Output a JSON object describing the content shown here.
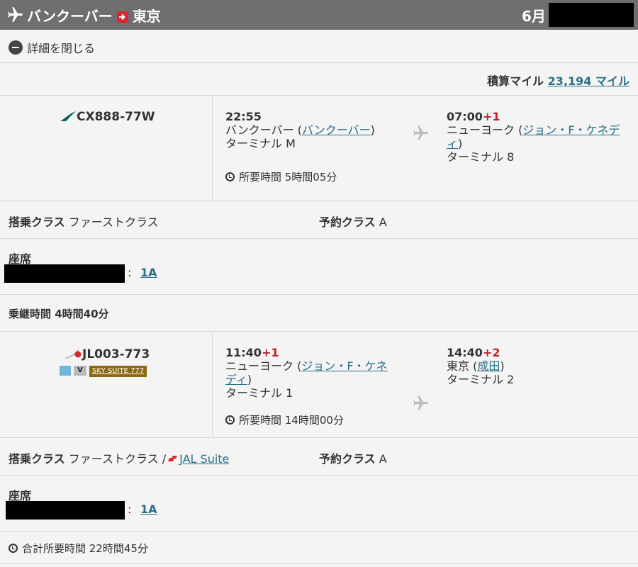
{
  "header": {
    "origin": "バンクーバー",
    "destination": "東京",
    "month": "6月"
  },
  "details_toggle": {
    "label": "詳細を閉じる"
  },
  "miles": {
    "label": "積算マイル",
    "value": "23,194 マイル"
  },
  "segments": [
    {
      "flight_number": "CX888-77W",
      "depart": {
        "time": "22:55",
        "day_offset": "",
        "city": "バンクーバー",
        "airport": "バンクーバー",
        "terminal": "ターミナル M"
      },
      "arrive": {
        "time": "07:00",
        "day_offset": "+1",
        "city": "ニューヨーク",
        "airport": "ジョン・F・ケネディ",
        "terminal": "ターミナル 8"
      },
      "duration": "所要時間 5時間05分",
      "cabin_label": "搭乗クラス",
      "cabin": "ファーストクラス",
      "booking_label": "予約クラス",
      "booking_class": "A",
      "seat_label": "座席",
      "seat": "1A"
    },
    {
      "flight_number": "JL003-773",
      "amenities": {
        "video_icon_text": "V",
        "suite_badge": "SKY SUITE 777"
      },
      "depart": {
        "time": "11:40",
        "day_offset": "+1",
        "city": "ニューヨーク",
        "airport": "ジョン・F・ケネディ",
        "terminal": "ターミナル 1"
      },
      "arrive": {
        "time": "14:40",
        "day_offset": "+2",
        "city": "東京",
        "airport": "成田",
        "terminal": "ターミナル 2"
      },
      "duration": "所要時間 14時間00分",
      "cabin_label": "搭乗クラス",
      "cabin": "ファーストクラス",
      "cabin_product": "JAL Suite",
      "booking_label": "予約クラス",
      "booking_class": "A",
      "seat_label": "座席",
      "seat": "1A"
    }
  ],
  "connection": {
    "text": "乗継時間 4時間40分"
  },
  "total": {
    "text": "合計所要時間 22時間45分"
  },
  "colors": {
    "header_bg": "#6f6f6f",
    "link": "#2a6f8a",
    "day_offset": "#c0232b",
    "cathay": "#00645a",
    "jal_red": "#d7282f"
  }
}
